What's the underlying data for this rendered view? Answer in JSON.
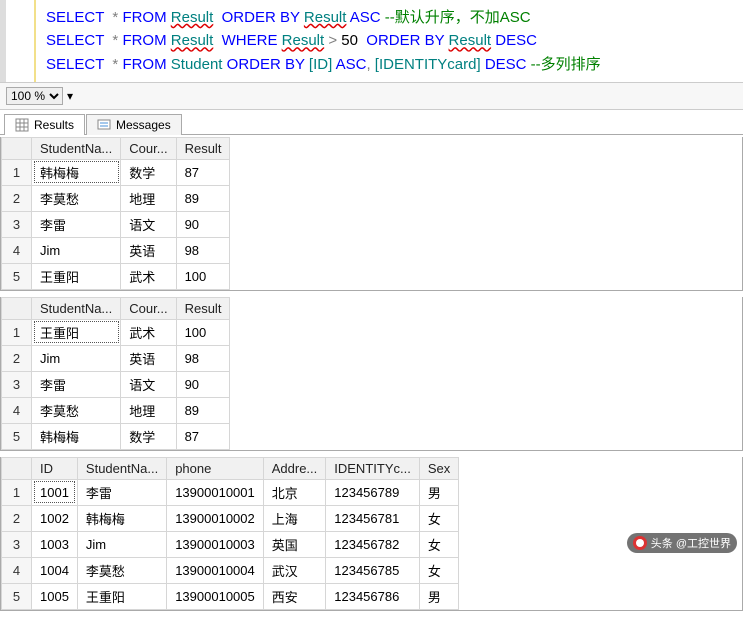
{
  "sql": {
    "lines": [
      {
        "tokens": [
          {
            "t": "SELECT ",
            "c": "kw"
          },
          {
            "t": " * ",
            "c": "op"
          },
          {
            "t": "FROM ",
            "c": "kw"
          },
          {
            "t": "Result",
            "c": "id underline"
          },
          {
            "t": "  ",
            "c": ""
          },
          {
            "t": "ORDER BY ",
            "c": "kw"
          },
          {
            "t": "Result",
            "c": "id underline"
          },
          {
            "t": " ",
            "c": ""
          },
          {
            "t": "ASC",
            "c": "kw"
          },
          {
            "t": " ",
            "c": ""
          },
          {
            "t": "--默认升序，不加ASC",
            "c": "cmt"
          }
        ]
      },
      {
        "tokens": [
          {
            "t": "SELECT ",
            "c": "kw"
          },
          {
            "t": " * ",
            "c": "op"
          },
          {
            "t": "FROM ",
            "c": "kw"
          },
          {
            "t": "Result",
            "c": "id underline"
          },
          {
            "t": "  ",
            "c": ""
          },
          {
            "t": "WHERE ",
            "c": "kw"
          },
          {
            "t": "Result",
            "c": "id underline"
          },
          {
            "t": " ",
            "c": ""
          },
          {
            "t": ">",
            "c": "op"
          },
          {
            "t": " 50  ",
            "c": ""
          },
          {
            "t": "ORDER BY ",
            "c": "kw"
          },
          {
            "t": "Result",
            "c": "id underline"
          },
          {
            "t": " ",
            "c": ""
          },
          {
            "t": "DESC",
            "c": "kw"
          }
        ]
      },
      {
        "tokens": [
          {
            "t": "SELECT ",
            "c": "kw"
          },
          {
            "t": " * ",
            "c": "op"
          },
          {
            "t": "FROM ",
            "c": "kw"
          },
          {
            "t": "Student",
            "c": "id"
          },
          {
            "t": " ",
            "c": ""
          },
          {
            "t": "ORDER BY ",
            "c": "kw"
          },
          {
            "t": "[ID]",
            "c": "id"
          },
          {
            "t": " ",
            "c": ""
          },
          {
            "t": "ASC",
            "c": "kw"
          },
          {
            "t": ", ",
            "c": "op"
          },
          {
            "t": "[IDENTITYcard]",
            "c": "id"
          },
          {
            "t": " ",
            "c": ""
          },
          {
            "t": "DESC",
            "c": "kw"
          },
          {
            "t": " ",
            "c": ""
          },
          {
            "t": "--多列排序",
            "c": "cmt"
          }
        ]
      }
    ]
  },
  "zoom": {
    "value": "100 %"
  },
  "tabs": {
    "results": "Results",
    "messages": "Messages"
  },
  "grid1": {
    "headers": [
      "StudentNa...",
      "Cour...",
      "Result"
    ],
    "rows": [
      [
        "韩梅梅",
        "数学",
        "87"
      ],
      [
        "李莫愁",
        "地理",
        "89"
      ],
      [
        "李雷",
        "语文",
        "90"
      ],
      [
        "Jim",
        "英语",
        "98"
      ],
      [
        "王重阳",
        "武术",
        "100"
      ]
    ]
  },
  "grid2": {
    "headers": [
      "StudentNa...",
      "Cour...",
      "Result"
    ],
    "rows": [
      [
        "王重阳",
        "武术",
        "100"
      ],
      [
        "Jim",
        "英语",
        "98"
      ],
      [
        "李雷",
        "语文",
        "90"
      ],
      [
        "李莫愁",
        "地理",
        "89"
      ],
      [
        "韩梅梅",
        "数学",
        "87"
      ]
    ]
  },
  "grid3": {
    "headers": [
      "ID",
      "StudentNa...",
      "phone",
      "Addre...",
      "IDENTITYc...",
      "Sex"
    ],
    "rows": [
      [
        "1001",
        "李雷",
        "13900010001",
        "北京",
        "123456789",
        "男"
      ],
      [
        "1002",
        "韩梅梅",
        "13900010002",
        "上海",
        "123456781",
        "女"
      ],
      [
        "1003",
        "Jim",
        "13900010003",
        "英国",
        "123456782",
        "女"
      ],
      [
        "1004",
        "李莫愁",
        "13900010004",
        "武汉",
        "123456785",
        "女"
      ],
      [
        "1005",
        "王重阳",
        "13900010005",
        "西安",
        "123456786",
        "男"
      ]
    ]
  },
  "watermark": {
    "label": "头条 @工控世界"
  }
}
